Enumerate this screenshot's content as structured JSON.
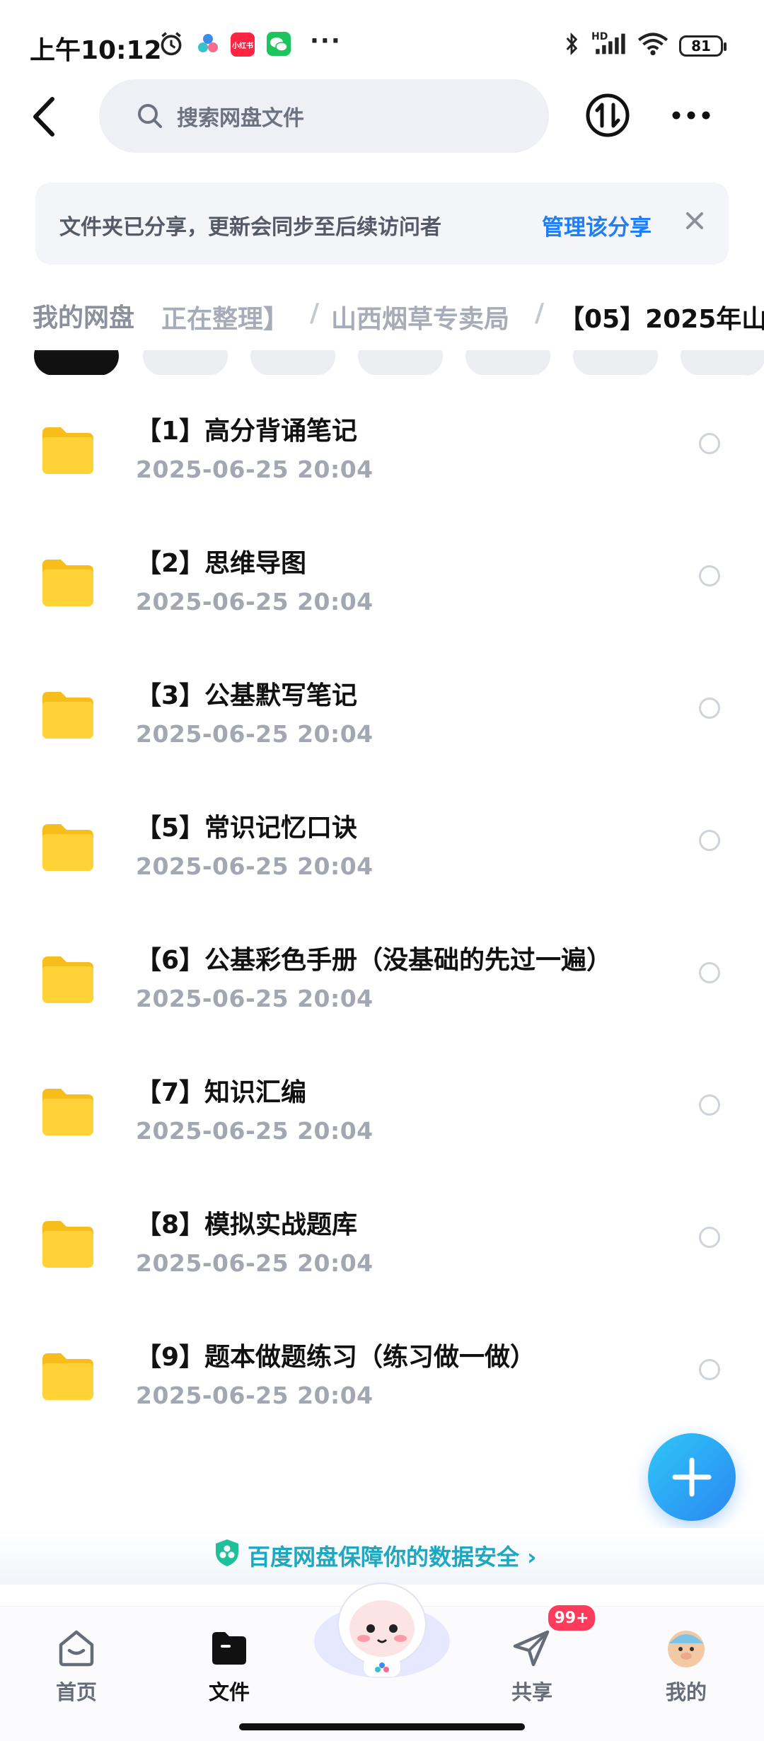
{
  "status_bar": {
    "time": "上午10:12",
    "app_label": "小红书",
    "more": "···",
    "network": "HD",
    "battery": "81"
  },
  "header": {
    "search_placeholder": "搜索网盘文件"
  },
  "share_banner": {
    "text": "文件夹已分享，更新会同步至后续访问者",
    "link": "管理该分享"
  },
  "breadcrumb": {
    "root": "我的网盘",
    "items": [
      "正在整理】",
      "山西烟草专卖局",
      "【05】2025年山"
    ],
    "separator": "/"
  },
  "files": [
    {
      "name": "【1】高分背诵笔记",
      "date": "2025-06-25  20:04"
    },
    {
      "name": "【2】思维导图",
      "date": "2025-06-25  20:04"
    },
    {
      "name": "【3】公基默写笔记",
      "date": "2025-06-25  20:04"
    },
    {
      "name": "【5】常识记忆口诀",
      "date": "2025-06-25  20:04"
    },
    {
      "name": "【6】公基彩色手册（没基础的先过一遍）",
      "date": "2025-06-25  20:04"
    },
    {
      "name": "【7】知识汇编",
      "date": "2025-06-25  20:04"
    },
    {
      "name": "【8】模拟实战题库",
      "date": "2025-06-25  20:04"
    },
    {
      "name": "【9】题本做题练习（练习做一做）",
      "date": "2025-06-25  20:04"
    }
  ],
  "security": {
    "text": "百度网盘保障你的数据安全 ›"
  },
  "nav": {
    "home": "首页",
    "files": "文件",
    "share": "共享",
    "mine": "我的",
    "share_badge": "99+"
  },
  "colors": {
    "accent": "#1f7ef5",
    "folder": "#ffcf33",
    "fab": "#2b86f3"
  }
}
